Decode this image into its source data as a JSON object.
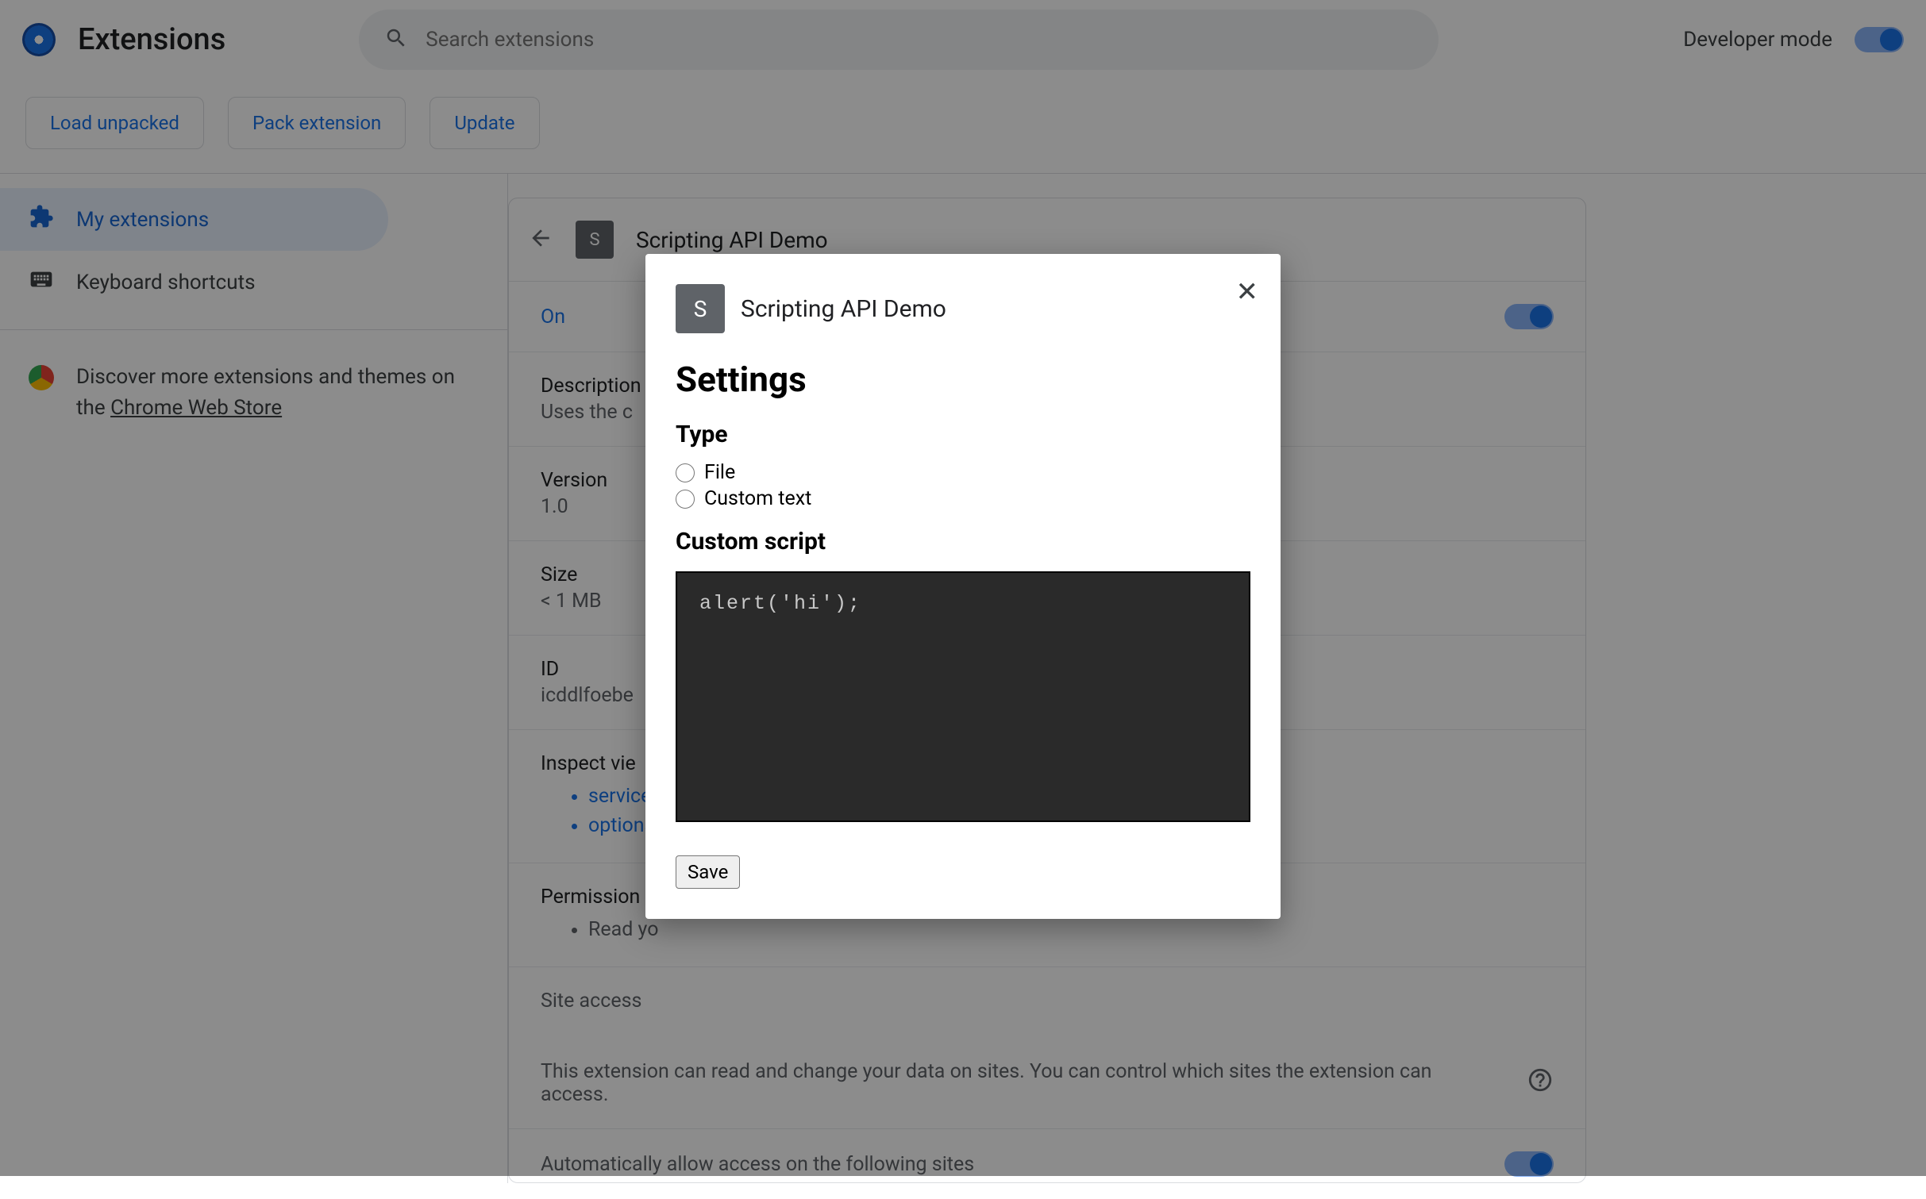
{
  "header": {
    "title": "Extensions",
    "search_placeholder": "Search extensions",
    "dev_mode_label": "Developer mode"
  },
  "actions": {
    "load_unpacked": "Load unpacked",
    "pack_extension": "Pack extension",
    "update": "Update"
  },
  "sidebar": {
    "my_extensions": "My extensions",
    "keyboard_shortcuts": "Keyboard shortcuts",
    "discover_prefix": "Discover more extensions and themes on the ",
    "discover_link": "Chrome Web Store"
  },
  "detail": {
    "name": "Scripting API Demo",
    "badge_letter": "S",
    "on_label": "On",
    "description_label": "Description",
    "description_value": "Uses the c",
    "version_label": "Version",
    "version_value": "1.0",
    "size_label": "Size",
    "size_value": "< 1 MB",
    "id_label": "ID",
    "id_value": "icddlfoebe",
    "inspect_label": "Inspect vie",
    "inspect_links": [
      "service",
      "options"
    ],
    "permissions_label": "Permission",
    "permissions_items": [
      "Read yo"
    ],
    "site_access_label": "Site access",
    "site_access_desc": "This extension can read and change your data on sites. You can control which sites the extension can access.",
    "auto_allow_label": "Automatically allow access on the following sites"
  },
  "modal": {
    "title": "Scripting API Demo",
    "badge_letter": "S",
    "settings_heading": "Settings",
    "type_heading": "Type",
    "radio_file": "File",
    "radio_custom": "Custom text",
    "custom_script_heading": "Custom script",
    "script_value": "alert('hi');",
    "save_label": "Save"
  }
}
